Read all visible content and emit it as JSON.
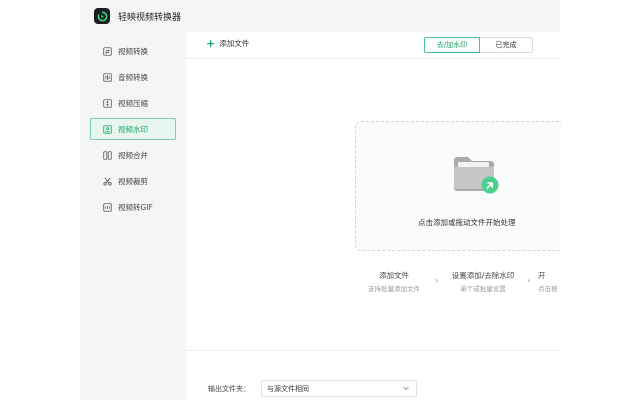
{
  "app": {
    "title": "轻映视频转换器"
  },
  "sidebar": {
    "items": [
      {
        "label": "视频转换",
        "icon": "convert-icon"
      },
      {
        "label": "音频转换",
        "icon": "audio-icon"
      },
      {
        "label": "视频压缩",
        "icon": "compress-icon"
      },
      {
        "label": "视频水印",
        "icon": "watermark-icon",
        "active": true
      },
      {
        "label": "视频合并",
        "icon": "merge-icon"
      },
      {
        "label": "视频裁剪",
        "icon": "scissors-icon"
      },
      {
        "label": "视频转GIF",
        "icon": "gif-icon"
      }
    ]
  },
  "toolbar": {
    "add_file": "添加文件",
    "tabs": [
      {
        "label": "去/加水印",
        "active": true
      },
      {
        "label": "已完成"
      }
    ]
  },
  "dropzone": {
    "text": "点击添加或拖动文件开始处理"
  },
  "steps": [
    {
      "title": "添加文件",
      "sub": "支持批量添加文件"
    },
    {
      "title": "设置添加/去除水印",
      "sub": "单个或批量设置"
    },
    {
      "title": "开",
      "sub": "点击按"
    }
  ],
  "output": {
    "label": "输出文件夹：",
    "value": "与源文件相同"
  },
  "colors": {
    "accent": "#17a36a",
    "active_bg": "#e6f5ee"
  }
}
